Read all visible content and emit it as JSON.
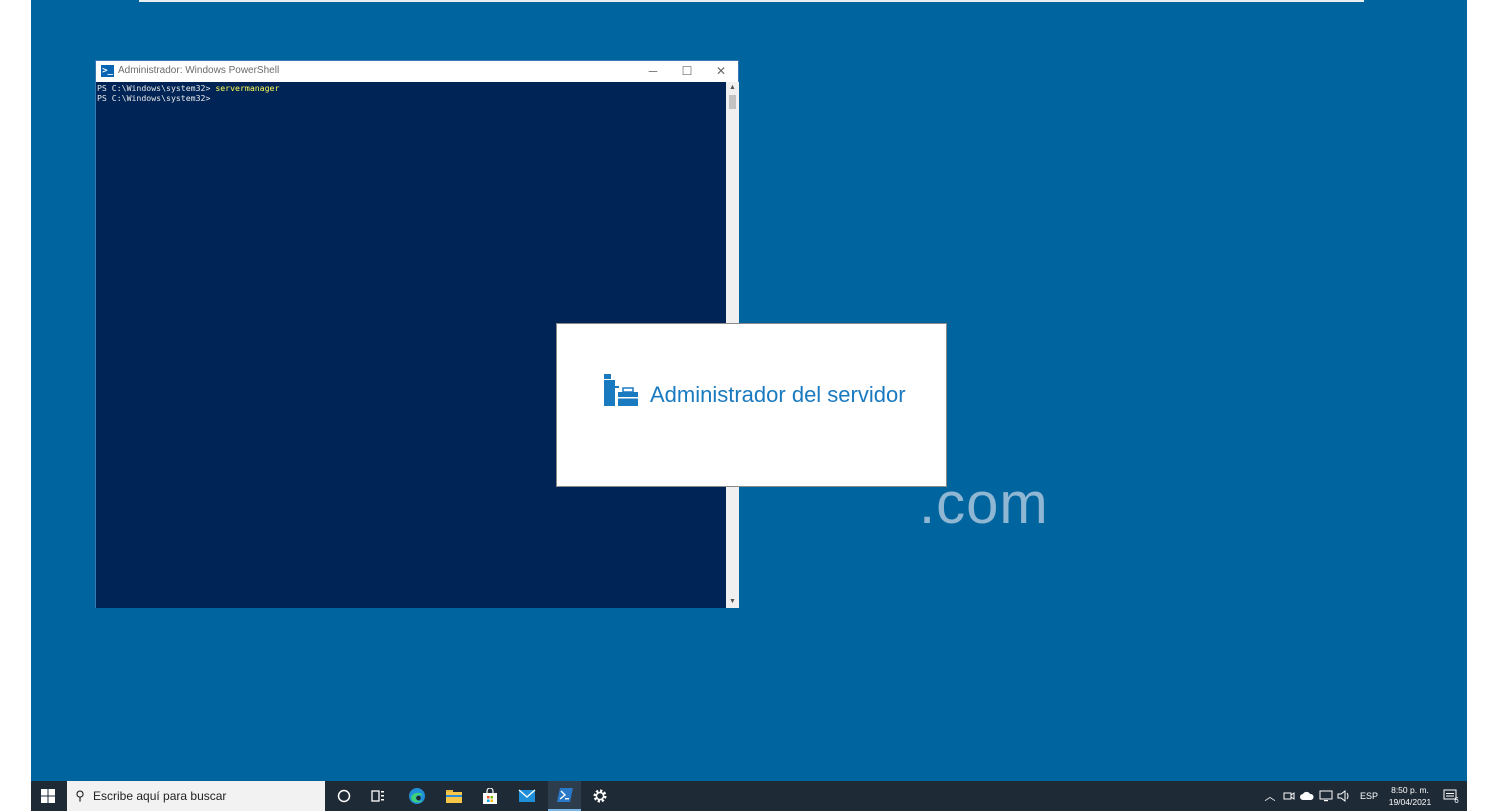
{
  "watermark": {
    "text": ".com"
  },
  "powershell": {
    "title": "Administrador: Windows PowerShell",
    "minimize_glyph": "─",
    "maximize_glyph": "☐",
    "close_glyph": "✕",
    "lines": [
      {
        "prompt": "PS C:\\Windows\\system32> ",
        "command": "servermanager"
      },
      {
        "prompt": "PS C:\\Windows\\system32> ",
        "command": ""
      }
    ]
  },
  "splash": {
    "title": "Administrador del servidor",
    "icon": "server-manager-icon"
  },
  "taskbar": {
    "search_placeholder": "Escribe aquí para buscar",
    "apps": [
      "cortana-icon",
      "task-view-icon",
      "edge-icon",
      "file-explorer-icon",
      "store-icon",
      "mail-icon",
      "powershell-icon",
      "settings-icon"
    ],
    "tray": {
      "language": "ESP",
      "time": "8:50 p. m.",
      "date": "19/04/2021",
      "notification_count": "6"
    }
  },
  "colors": {
    "desktop": "#00659e",
    "console_bg": "#012456",
    "command_text": "#ffff54",
    "splash_title": "#1a7ac0",
    "taskbar": "#1e2a36"
  }
}
